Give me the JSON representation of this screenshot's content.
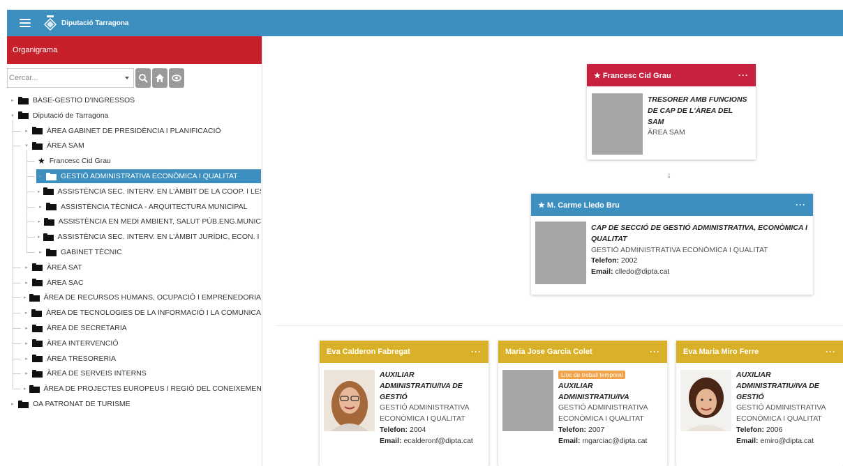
{
  "header": {
    "brand": "Diputació Tarragona",
    "bar_color": "#3d8fbf"
  },
  "sidebar": {
    "title": "Organigrama",
    "search_placeholder": "Cercar...",
    "icons": [
      "search-icon",
      "home-icon",
      "eye-icon"
    ],
    "tree": [
      {
        "label": "BASE-GESTIO D'INGRESSOS",
        "type": "folder",
        "level": 0,
        "toggle": "▸"
      },
      {
        "label": "Diputació de Tarragona",
        "type": "folder",
        "level": 0,
        "toggle": "▾"
      },
      {
        "label": "ÀREA GABINET DE PRESIDÈNCIA I PLANIFICACIÓ",
        "type": "folder",
        "level": 1,
        "toggle": "▸"
      },
      {
        "label": "ÀREA SAM",
        "type": "folder",
        "level": 1,
        "toggle": "▾"
      },
      {
        "label": "Francesc Cid Grau",
        "type": "person",
        "level": 2,
        "toggle": ""
      },
      {
        "label": "GESTIÓ ADMINISTRATIVA ECONÒMICA I QUALITAT",
        "type": "folder",
        "level": 2,
        "toggle": "▸",
        "selected": true
      },
      {
        "label": "ASSISTÈNCIA SEC. INTERV. EN L'ÀMBIT DE LA COOP. I LES",
        "type": "folder",
        "level": 2,
        "toggle": "▸"
      },
      {
        "label": "ASSISTÈNCIA TÈCNICA - ARQUITECTURA MUNICIPAL",
        "type": "folder",
        "level": 2,
        "toggle": "▸"
      },
      {
        "label": "ASSISTÈNCIA EN MEDI AMBIENT, SALUT PÚB.ENG.MUNIC",
        "type": "folder",
        "level": 2,
        "toggle": "▸"
      },
      {
        "label": "ASSISTÈNCIA SEC. INTERV. EN L'ÀMBIT JURÍDIC, ECON. I FI",
        "type": "folder",
        "level": 2,
        "toggle": "▸"
      },
      {
        "label": "GABINET TÈCNIC",
        "type": "folder",
        "level": 2,
        "toggle": "▸"
      },
      {
        "label": "ÀREA SAT",
        "type": "folder",
        "level": 1,
        "toggle": "▸"
      },
      {
        "label": "ÀREA SAC",
        "type": "folder",
        "level": 1,
        "toggle": "▸"
      },
      {
        "label": "ÀREA DE RECURSOS HUMANS, OCUPACIÓ I EMPRENEDORIA",
        "type": "folder",
        "level": 1,
        "toggle": "▸"
      },
      {
        "label": "ÀREA DE TECNOLOGIES DE LA INFORMACIÓ I LA COMUNICA",
        "type": "folder",
        "level": 1,
        "toggle": "▸"
      },
      {
        "label": "ÀREA DE SECRETARIA",
        "type": "folder",
        "level": 1,
        "toggle": "▸"
      },
      {
        "label": "ÀREA INTERVENCIÓ",
        "type": "folder",
        "level": 1,
        "toggle": "▸"
      },
      {
        "label": "ÀREA TRESORERIA",
        "type": "folder",
        "level": 1,
        "toggle": "▸"
      },
      {
        "label": "ÀREA DE SERVEIS INTERNS",
        "type": "folder",
        "level": 1,
        "toggle": "▸"
      },
      {
        "label": "ÀREA DE PROJECTES EUROPEUS I REGIÓ DEL CONEIXEMENT",
        "type": "folder",
        "level": 1,
        "toggle": "▸"
      },
      {
        "label": "OA PATRONAT DE TURISME",
        "type": "folder",
        "level": 0,
        "toggle": "▸"
      }
    ]
  },
  "org": {
    "top": {
      "name": "★ Francesc Cid Grau",
      "title": "TRESORER AMB FUNCIONS DE CAP DE L'ÀREA DEL SAM",
      "dept": "ÀREA SAM",
      "color": "#c8203f"
    },
    "mid": {
      "name": "★ M. Carme Lledo Bru",
      "title": "CAP DE SECCIÓ DE GESTIÓ ADMINISTRATIVA, ECONÒMICA I QUALITAT",
      "dept": "GESTIÓ ADMINISTRATIVA ECONÒMICA I QUALITAT",
      "phone_label": "Telefon:",
      "phone": "2002",
      "email_label": "Email:",
      "email": "clledo@dipta.cat",
      "color": "#3d8fbf"
    },
    "staff": [
      {
        "name": "Eva Calderon Fabregat",
        "title": "AUXILIAR ADMINISTRATIU/IVA DE GESTIÓ",
        "dept": "GESTIÓ ADMINISTRATIVA ECONÒMICA I QUALITAT",
        "phone_label": "Telefon:",
        "phone": "2004",
        "email_label": "Email:",
        "email": "ecalderonf@dipta.cat"
      },
      {
        "name": "Maria Jose Garcia Colet",
        "badge": "Lloc de treball temporal",
        "title": "AUXILIAR ADMINISTRATIU/IVA",
        "dept": "GESTIÓ ADMINISTRATIVA ECONÒMICA I QUALITAT",
        "phone_label": "Telefon:",
        "phone": "2007",
        "email_label": "Email:",
        "email": "mgarciac@dipta.cat"
      },
      {
        "name": "Eva Maria Miro Ferre",
        "title": "AUXILIAR ADMINISTRATIU/IVA DE GESTIÓ",
        "dept": "GESTIÓ ADMINISTRATIVA ECONÒMICA I QUALITAT",
        "phone_label": "Telefon:",
        "phone": "2006",
        "email_label": "Email:",
        "email": "emiro@dipta.cat"
      }
    ],
    "staff_color": "#d9b128",
    "menu_dots": "···"
  }
}
